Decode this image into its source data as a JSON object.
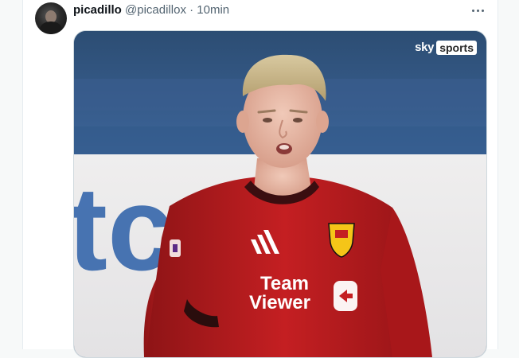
{
  "tweet": {
    "display_name": "picadillo",
    "handle": "@picadillox",
    "separator": "·",
    "time": "10min"
  },
  "media": {
    "broadcaster_logo_sky": "sky",
    "broadcaster_logo_sports": "sports",
    "shirt_sponsor_line1": "Team",
    "shirt_sponsor_line2": "Viewer",
    "background_text": "tc"
  },
  "icons": {
    "more": "more-options-icon"
  }
}
